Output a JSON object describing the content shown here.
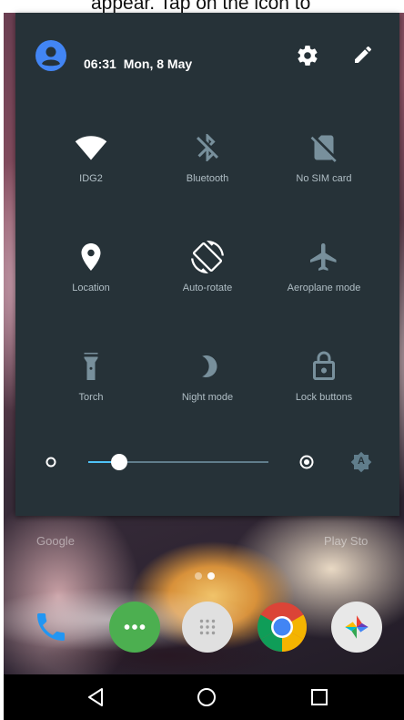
{
  "caption": "appear. Tap on the icon to",
  "header": {
    "time": "06:31",
    "date": "Mon, 8 May"
  },
  "tiles": [
    {
      "label": "IDG2",
      "icon": "wifi-icon",
      "active": true
    },
    {
      "label": "Bluetooth",
      "icon": "bluetooth-off-icon",
      "active": false
    },
    {
      "label": "No SIM card",
      "icon": "no-sim-icon",
      "active": false
    },
    {
      "label": "Location",
      "icon": "location-icon",
      "active": true
    },
    {
      "label": "Auto-rotate",
      "icon": "auto-rotate-icon",
      "active": true
    },
    {
      "label": "Aeroplane mode",
      "icon": "aeroplane-icon",
      "active": false
    },
    {
      "label": "Torch",
      "icon": "torch-icon",
      "active": false
    },
    {
      "label": "Night mode",
      "icon": "night-mode-icon",
      "active": false
    },
    {
      "label": "Lock buttons",
      "icon": "lock-icon",
      "active": false
    }
  ],
  "brightness": {
    "level": 0.17,
    "auto": "A"
  },
  "home": {
    "app_labels": [
      "Google",
      "Play Sto"
    ]
  },
  "colors": {
    "panel": "#263238",
    "active_icon": "#ffffff",
    "inactive_icon": "#78909c",
    "label": "#b0bec5",
    "accent": "#4fc3f7",
    "avatar": "#4285f4"
  }
}
